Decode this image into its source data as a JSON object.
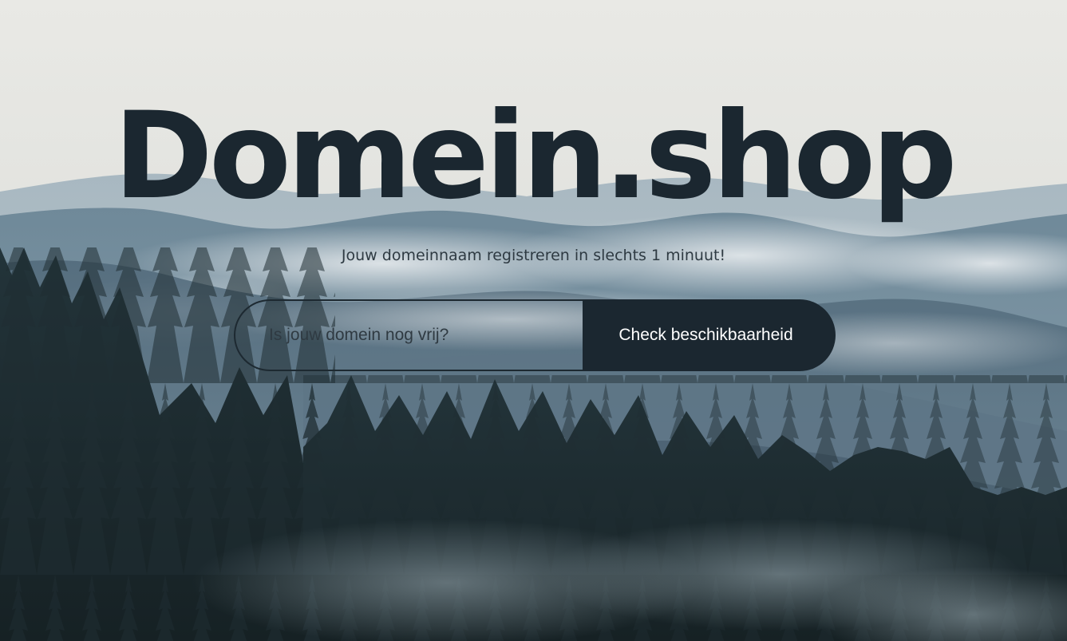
{
  "hero": {
    "brand_title": "Domein.shop",
    "tagline": "Jouw domeinnaam registreren in slechts 1 minuut!"
  },
  "search": {
    "placeholder": "Is jouw domein nog vrij?",
    "value": "",
    "button_label": "Check beschikbaarheid"
  },
  "colors": {
    "primary_dark": "#1b2730",
    "text_on_dark": "#ffffff",
    "sky": "#e8e8e4",
    "mountains": "#6c8696",
    "forest": "#1e2b2f"
  }
}
